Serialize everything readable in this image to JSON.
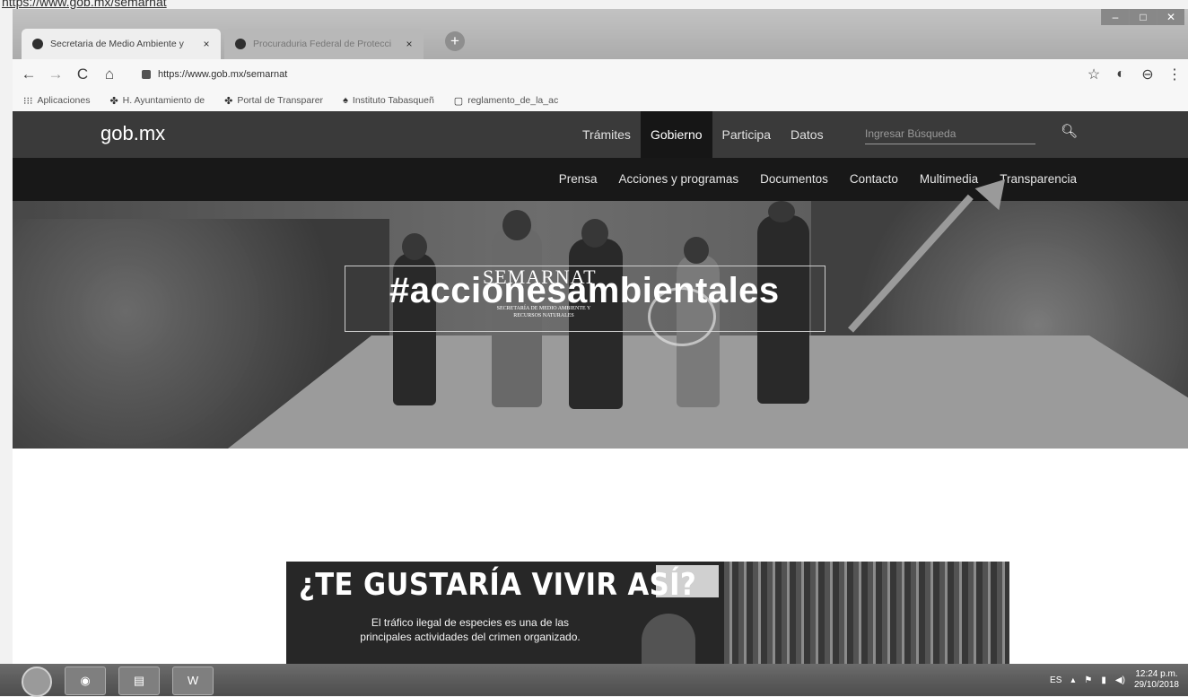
{
  "top_url": "https://www.gob.mx/semarnat",
  "window_controls": [
    "–",
    "□",
    "✕"
  ],
  "tabs": [
    {
      "title": "Secretaria de Medio Ambiente y",
      "close": "×"
    },
    {
      "title": "Procuraduria Federal de Protecci",
      "close": "×"
    }
  ],
  "new_tab_label": "+",
  "toolbar": {
    "back": "←",
    "forward": "→",
    "reload": "C",
    "home": "⌂",
    "url": "https://www.gob.mx/semarnat",
    "star": "☆",
    "ext": "◐",
    "account": "⊖",
    "menu": "⋮"
  },
  "bookmarks": [
    {
      "icon": "⁝⁝⁝",
      "label": "Aplicaciones"
    },
    {
      "icon": "✤",
      "label": "H. Ayuntamiento de"
    },
    {
      "icon": "✤",
      "label": "Portal de Transparer"
    },
    {
      "icon": "♠",
      "label": "Instituto Tabasqueñ"
    },
    {
      "icon": "▢",
      "label": "reglamento_de_la_ac"
    }
  ],
  "site": {
    "logo": "gob.mx",
    "top_nav": [
      "Trámites",
      "Gobierno",
      "Participa",
      "Datos"
    ],
    "search_placeholder": "Ingresar Búsqueda",
    "search_icon": "🔍︎",
    "sub_nav": [
      "Prensa",
      "Acciones y programas",
      "Documentos",
      "Contacto",
      "Multimedia",
      "Transparencia"
    ]
  },
  "hero": {
    "hashtag": "#accionesambientales",
    "semarnat": "SEMARNAT",
    "semarnat_sub": "SECRETARÍA DE MEDIO AMBIENTE Y RECURSOS NATURALES"
  },
  "banner": {
    "title": "¿TE GUSTARÍA VIVIR ASÍ?",
    "text": "El tráfico ilegal de especies es una de las principales actividades del crimen organizado."
  },
  "taskbar": {
    "apps": [
      "◉",
      "▤",
      "W"
    ],
    "lang": "ES",
    "time": "12:24 p.m.",
    "date": "29/10/2018"
  }
}
